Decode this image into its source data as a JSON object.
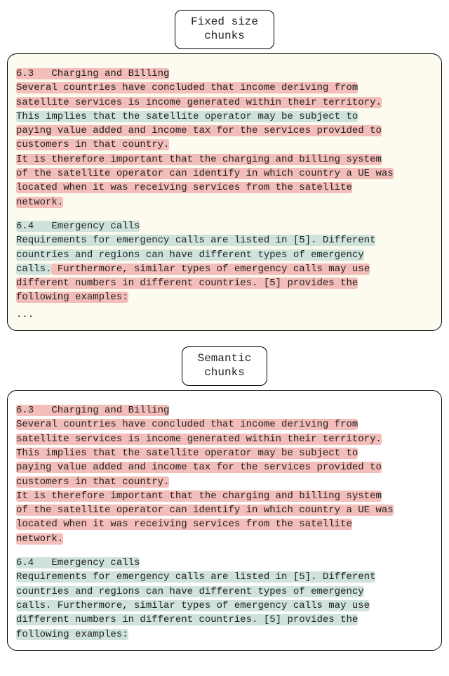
{
  "labels": {
    "fixed_line1": "Fixed size",
    "fixed_line2": "chunks",
    "semantic_line1": "Semantic",
    "semantic_line2": "chunks"
  },
  "fixed_panel": {
    "s63_title": "6.3   Charging and Billing",
    "s63_l1": "Several countries have concluded that income deriving from",
    "s63_l2": "satellite services is income generated within their territory.",
    "s63_l3a": "This implies that the satellite operator may be subject to",
    "s63_l4": "paying value added and income tax for the services provided to",
    "s63_l5": "customers in that country.",
    "s63_l6": "It is therefore important that the charging and billing system",
    "s63_l7": "of the satellite operator can identify in which country a UE was",
    "s63_l8": "located when it was receiving services from the satellite",
    "s63_l9": "network.",
    "s64_title": "6.4   Emergency calls",
    "s64_l1": "Requirements for emergency calls are listed in [5]. Different",
    "s64_l2": "countries and regions can have different types of emergency",
    "s64_l3a": "calls.",
    "s64_l3b": " Furthermore, similar types of emergency calls may use",
    "s64_l4": "different numbers in different countries. [5] provides the",
    "s64_l5": "following examples:",
    "ellipsis": "..."
  },
  "semantic_panel": {
    "s63_title": "6.3   Charging and Billing",
    "s63_l1": "Several countries have concluded that income deriving from",
    "s63_l2": "satellite services is income generated within their territory.",
    "s63_l3": "This implies that the satellite operator may be subject to",
    "s63_l4": "paying value added and income tax for the services provided to",
    "s63_l5": "customers in that country.",
    "s63_l6": "It is therefore important that the charging and billing system",
    "s63_l7": "of the satellite operator can identify in which country a UE was",
    "s63_l8": "located when it was receiving services from the satellite",
    "s63_l9": "network.",
    "s64_title": "6.4   Emergency calls",
    "s64_l1": "Requirements for emergency calls are listed in [5]. Different",
    "s64_l2": "countries and regions can have different types of emergency",
    "s64_l3": "calls. Furthermore, similar types of emergency calls may use",
    "s64_l4": "different numbers in different countries. [5] provides the",
    "s64_l5": "following examples:"
  }
}
